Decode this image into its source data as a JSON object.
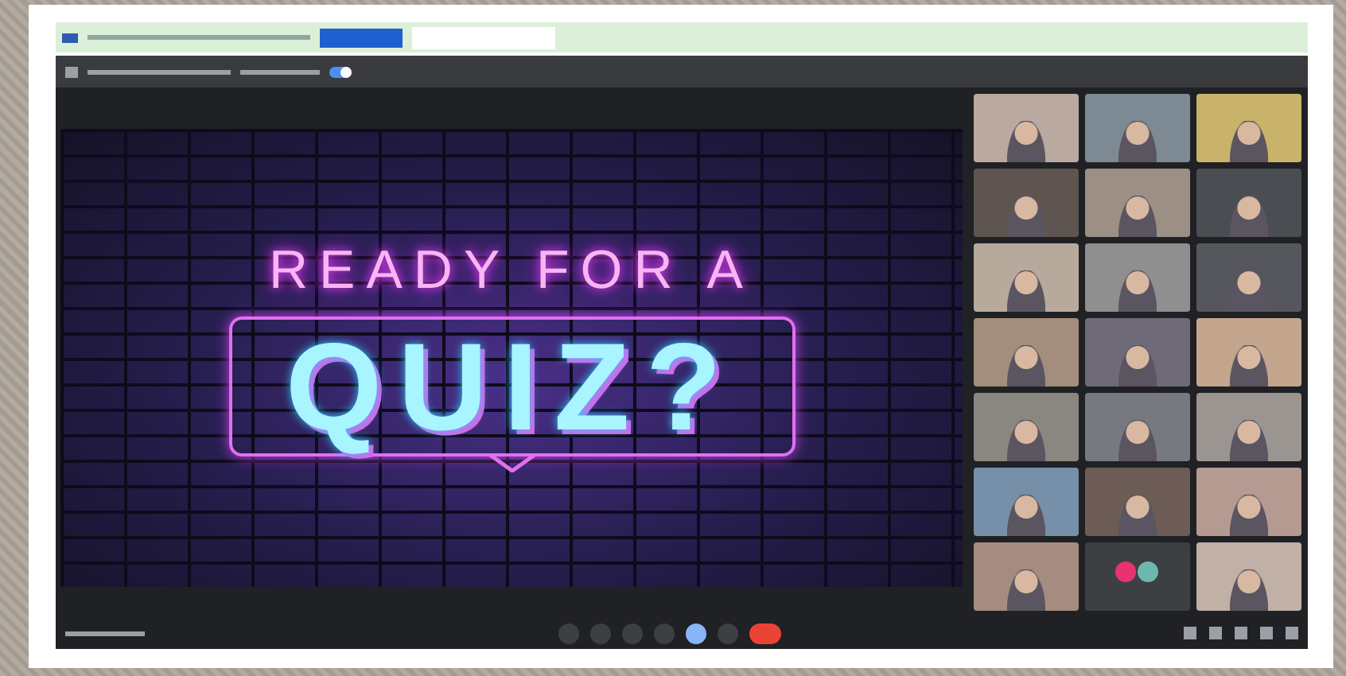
{
  "presenting_toggle": {
    "on": true
  },
  "slide": {
    "line_1": "READY FOR A",
    "line_2": "QUIZ?"
  },
  "participants": [
    {
      "kind": "video"
    },
    {
      "kind": "video"
    },
    {
      "kind": "video"
    },
    {
      "kind": "video"
    },
    {
      "kind": "video"
    },
    {
      "kind": "video"
    },
    {
      "kind": "video"
    },
    {
      "kind": "video"
    },
    {
      "kind": "video"
    },
    {
      "kind": "video"
    },
    {
      "kind": "video"
    },
    {
      "kind": "video"
    },
    {
      "kind": "video"
    },
    {
      "kind": "video"
    },
    {
      "kind": "video"
    },
    {
      "kind": "video"
    },
    {
      "kind": "video"
    },
    {
      "kind": "video"
    },
    {
      "kind": "video"
    },
    {
      "kind": "avatar"
    },
    {
      "kind": "video"
    }
  ],
  "controls": [
    {
      "kind": "plain"
    },
    {
      "kind": "plain"
    },
    {
      "kind": "plain"
    },
    {
      "kind": "plain"
    },
    {
      "kind": "active"
    },
    {
      "kind": "plain"
    },
    {
      "kind": "end"
    }
  ],
  "side_controls": [
    {
      "kind": "plain"
    },
    {
      "kind": "plain"
    },
    {
      "kind": "plain"
    },
    {
      "kind": "plain"
    },
    {
      "kind": "plain"
    }
  ]
}
